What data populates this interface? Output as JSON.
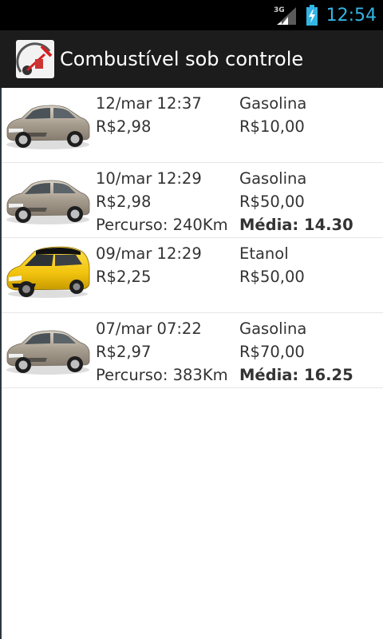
{
  "status": {
    "network": "3G",
    "time": "12:54"
  },
  "app": {
    "title": "Combustível sob controle"
  },
  "entries": [
    {
      "car": "silver-sedan",
      "datetime": "12/mar 12:37",
      "price": "R$2,98",
      "fuel": "Gasolina",
      "amount": "R$10,00",
      "route": "",
      "average": ""
    },
    {
      "car": "silver-sedan",
      "datetime": "10/mar 12:29",
      "price": "R$2,98",
      "fuel": "Gasolina",
      "amount": "R$50,00",
      "route": "Percurso: 240Km",
      "average": "Média: 14.30"
    },
    {
      "car": "yellow-hatchback",
      "datetime": "09/mar 12:29",
      "price": "R$2,25",
      "fuel": "Etanol",
      "amount": "R$50,00",
      "route": "",
      "average": ""
    },
    {
      "car": "silver-sedan",
      "datetime": "07/mar 07:22",
      "price": "R$2,97",
      "fuel": "Gasolina",
      "amount": "R$70,00",
      "route": "Percurso: 383Km",
      "average": "Média: 16.25"
    }
  ],
  "colors": {
    "accent": "#33b5e5",
    "title_bar": "#1c1c1c",
    "text": "#333333",
    "silver_car": "#a89c8c",
    "yellow_car": "#f2c40f"
  }
}
